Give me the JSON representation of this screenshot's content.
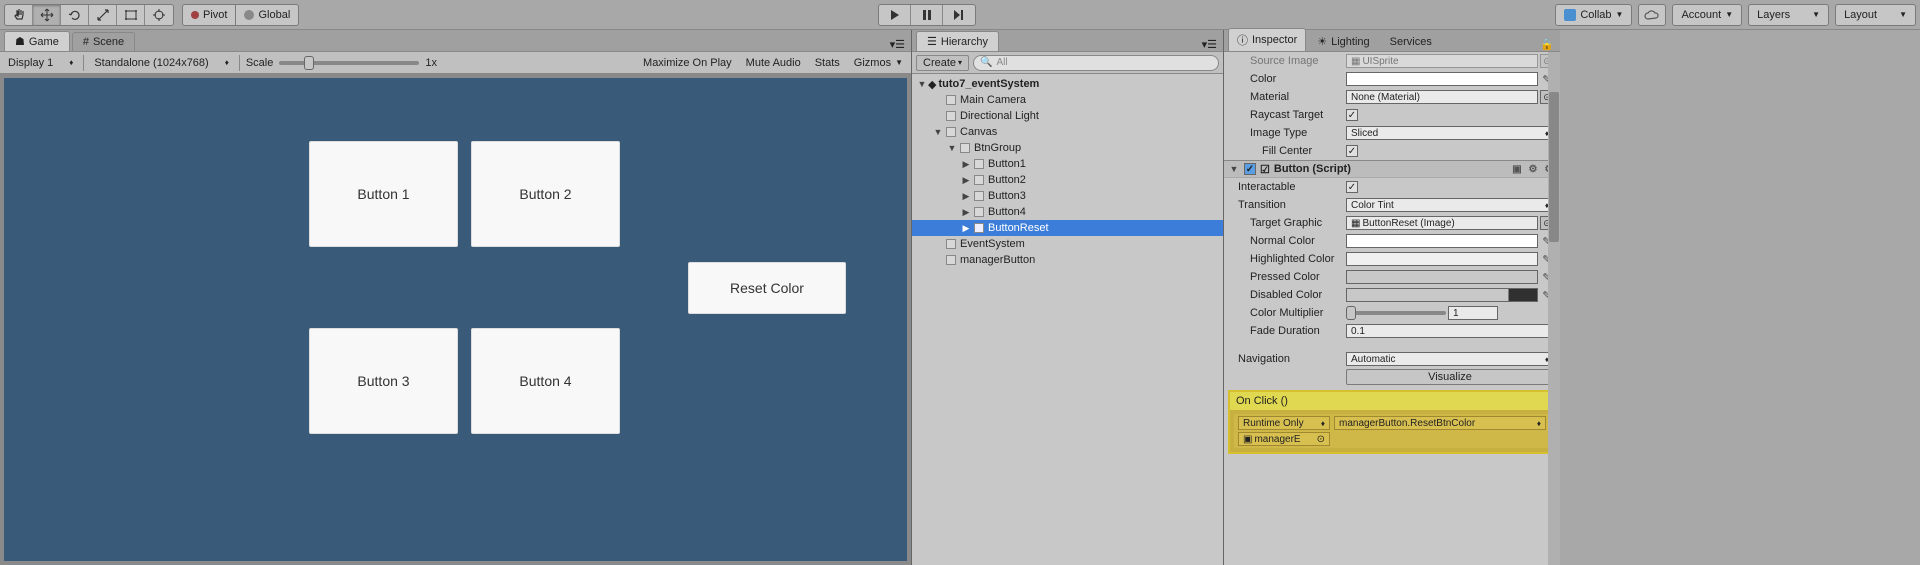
{
  "toolbar": {
    "pivot": "Pivot",
    "global": "Global",
    "collab": "Collab",
    "account": "Account",
    "layers": "Layers",
    "layout": "Layout"
  },
  "tabs": {
    "game": "Game",
    "scene": "Scene"
  },
  "gameToolbar": {
    "display": "Display 1",
    "aspect": "Standalone (1024x768)",
    "scale": "Scale",
    "scaleValue": "1x",
    "maximize": "Maximize On Play",
    "muteAudio": "Mute Audio",
    "stats": "Stats",
    "gizmos": "Gizmos"
  },
  "gameButtons": {
    "b1": "Button 1",
    "b2": "Button 2",
    "b3": "Button 3",
    "b4": "Button 4",
    "reset": "Reset Color"
  },
  "hierarchy": {
    "title": "Hierarchy",
    "create": "Create",
    "searchPlaceholder": "All",
    "scene": "tuto7_eventSystem",
    "items": {
      "mainCamera": "Main Camera",
      "directionalLight": "Directional Light",
      "canvas": "Canvas",
      "btnGroup": "BtnGroup",
      "button1": "Button1",
      "button2": "Button2",
      "button3": "Button3",
      "button4": "Button4",
      "buttonReset": "ButtonReset",
      "eventSystem": "EventSystem",
      "managerButton": "managerButton"
    }
  },
  "inspector": {
    "title": "Inspector",
    "lighting": "Lighting",
    "services": "Services",
    "sourceImage": "Source Image",
    "sourceImageValue": "UISprite",
    "color": "Color",
    "material": "Material",
    "materialValue": "None (Material)",
    "raycastTarget": "Raycast Target",
    "imageType": "Image Type",
    "imageTypeValue": "Sliced",
    "fillCenter": "Fill Center",
    "buttonScript": "Button (Script)",
    "interactable": "Interactable",
    "transition": "Transition",
    "transitionValue": "Color Tint",
    "targetGraphic": "Target Graphic",
    "targetGraphicValue": "ButtonReset (Image)",
    "normalColor": "Normal Color",
    "highlightedColor": "Highlighted Color",
    "pressedColor": "Pressed Color",
    "disabledColor": "Disabled Color",
    "colorMultiplier": "Color Multiplier",
    "colorMultiplierValue": "1",
    "fadeDuration": "Fade Duration",
    "fadeDurationValue": "0.1",
    "navigation": "Navigation",
    "navigationValue": "Automatic",
    "visualize": "Visualize",
    "onClick": "On Click ()",
    "runtimeOnly": "Runtime Only",
    "onClickMethod": "managerButton.ResetBtnColor",
    "onClickObj": "managerE"
  }
}
